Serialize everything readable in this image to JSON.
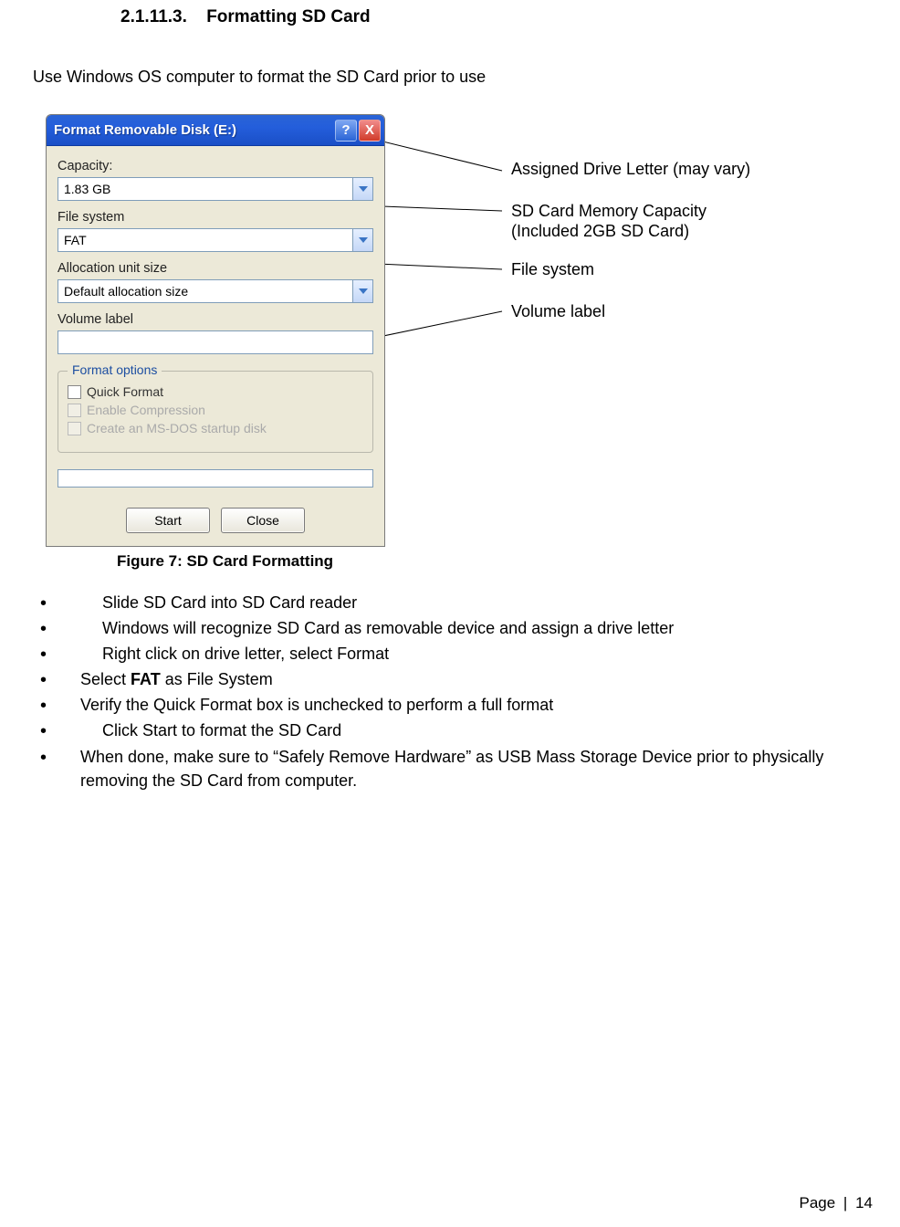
{
  "heading": {
    "number": "2.1.11.3.",
    "title": "Formatting SD Card"
  },
  "intro": "Use Windows OS computer to format the SD Card prior to use",
  "dialog": {
    "title": "Format Removable Disk (E:)",
    "help": "?",
    "close": "X",
    "capacity_label": "Capacity:",
    "capacity_value": "1.83 GB",
    "fs_label": "File system",
    "fs_value": "FAT",
    "alloc_label": "Allocation unit size",
    "alloc_value": "Default allocation size",
    "vol_label": "Volume label",
    "vol_value": "",
    "options_legend": "Format options",
    "opt_quick": "Quick Format",
    "opt_compress": "Enable Compression",
    "opt_msdos": "Create an MS-DOS startup disk",
    "start": "Start",
    "cancel": "Close"
  },
  "annotations": {
    "a1": "Assigned Drive Letter (may vary)",
    "a2a": "SD Card Memory Capacity",
    "a2b": "(Included 2GB SD Card)",
    "a3": "File system",
    "a4": "Volume label"
  },
  "caption": "Figure 7: SD Card Formatting",
  "steps": {
    "s1": "Slide SD Card into SD Card reader",
    "s2": "Windows will recognize SD Card as removable device and assign a drive letter",
    "s3": "Right click on drive letter, select Format",
    "s4a": "Select ",
    "s4b": "FAT",
    "s4c": " as File System",
    "s5": "Verify the Quick Format box is unchecked to perform a full format",
    "s6": "Click Start to format the SD Card",
    "s7": "When done, make sure to “Safely Remove Hardware” as USB Mass Storage Device prior to physically removing the SD Card from computer."
  },
  "footer": {
    "label": "Page",
    "sep": "|",
    "num": "14"
  }
}
